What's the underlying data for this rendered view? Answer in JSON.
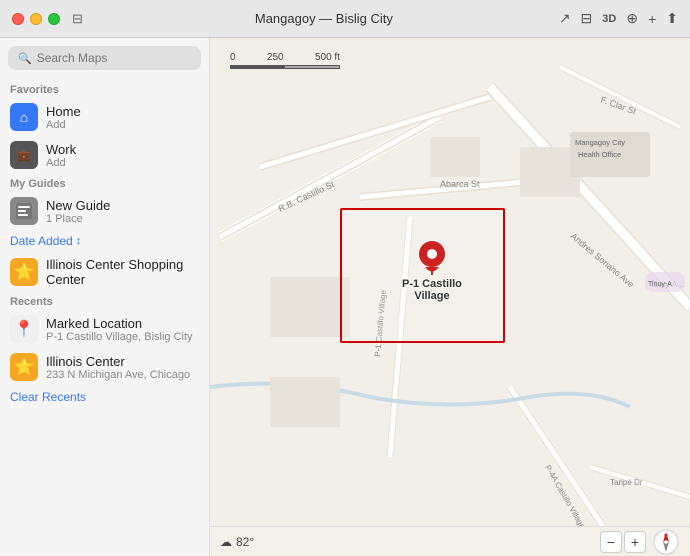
{
  "titleBar": {
    "title": "Mangagoy — Bislig City",
    "mapIcon": "□",
    "icons": [
      "↗",
      "⊞",
      "3D",
      "⊕",
      "+",
      "⬆"
    ]
  },
  "sidebar": {
    "searchPlaceholder": "Search Maps",
    "sections": {
      "favorites": {
        "label": "Favorites",
        "items": [
          {
            "name": "Home",
            "sub": "Add",
            "iconType": "blue",
            "icon": "⌂"
          },
          {
            "name": "Work",
            "sub": "Add",
            "iconType": "dark",
            "icon": "💼"
          }
        ]
      },
      "myGuides": {
        "label": "My Guides",
        "items": [
          {
            "name": "New Guide",
            "sub": "1 Place",
            "iconType": "guide",
            "icon": "▦"
          }
        ]
      },
      "dateAdded": "Date Added",
      "guidesItems": [
        {
          "name": "Illinois Center Shopping Center",
          "iconType": "orange",
          "icon": "⭐"
        }
      ],
      "recents": {
        "label": "Recents",
        "items": [
          {
            "name": "Marked Location",
            "sub": "P-1 Castillo Village, Bislig City",
            "iconType": "red-pin",
            "icon": "📍"
          },
          {
            "name": "Illinois Center",
            "sub": "233 N Michigan Ave, Chicago",
            "iconType": "orange",
            "icon": "⭐"
          }
        ]
      },
      "clearRecents": "Clear Recents"
    }
  },
  "map": {
    "scaleLabels": [
      "0",
      "250",
      "500 ft"
    ],
    "pinLabel": "P-1 Castillo\nVillage",
    "healthOfficeLabel": "Mangagoy City\nHealth Office",
    "weather": "82°",
    "weatherIcon": "☁",
    "zoomMinus": "−",
    "zoomPlus": "+",
    "compass": "N",
    "roadLabels": [
      "R.B. Castillo St",
      "Abarca St",
      "Andres Soriano Ave",
      "F. Clar St",
      "P-1 Castillo Village",
      "P-4A Castillo Village",
      "Taripé Dr",
      "Tinuy-A..."
    ]
  }
}
